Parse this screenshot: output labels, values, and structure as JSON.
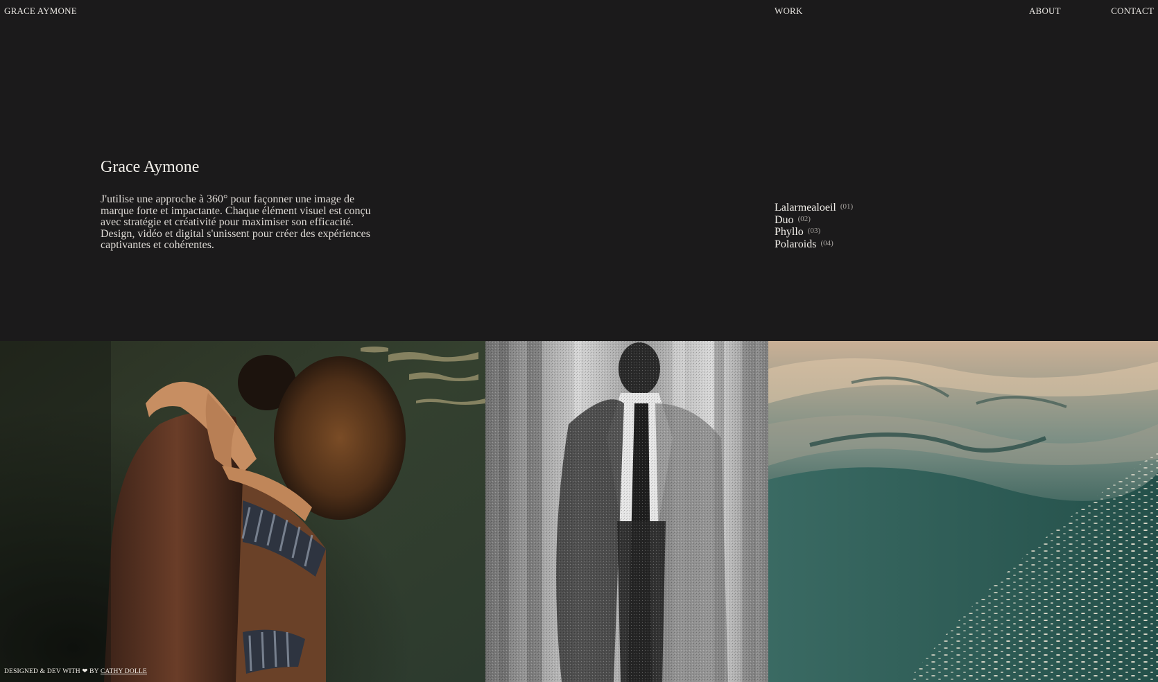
{
  "header": {
    "brand": "GRACE AYMONE",
    "nav": {
      "work": "WORK",
      "about": "ABOUT",
      "contact": "CONTACT"
    }
  },
  "intro": {
    "title": "Grace Aymone",
    "text": "J'utilise une approche à 360° pour façonner une image de marque forte et impactante. Chaque élément visuel est conçu avec stratégie et créativité pour maximiser son efficacité. Design, vidéo et digital s'unissent pour créer des expériences captivantes et cohérentes."
  },
  "projects": [
    {
      "name": "Lalarmealoeil",
      "number": "(01)"
    },
    {
      "name": "Duo",
      "number": "(02)"
    },
    {
      "name": "Phyllo",
      "number": "(03)"
    },
    {
      "name": "Polaroids",
      "number": "(04)"
    }
  ],
  "gallery": [
    {
      "subject": "couple-embracing-in-water-photo",
      "tone": "#2f3a2a"
    },
    {
      "subject": "man-behind-curtain-bw-photo",
      "tone": "#8a8a8a"
    },
    {
      "subject": "water-surface-photo",
      "tone": "#2e5a54"
    }
  ],
  "footer": {
    "credit_prefix": "DESIGNED & DEV WITH",
    "heart": "❤",
    "credit_by": "BY",
    "credit_link": "CATHY DOLLE"
  },
  "colors": {
    "background": "#1b1a1b",
    "text": "#e9e6e2",
    "muted": "#a8a4a0"
  }
}
